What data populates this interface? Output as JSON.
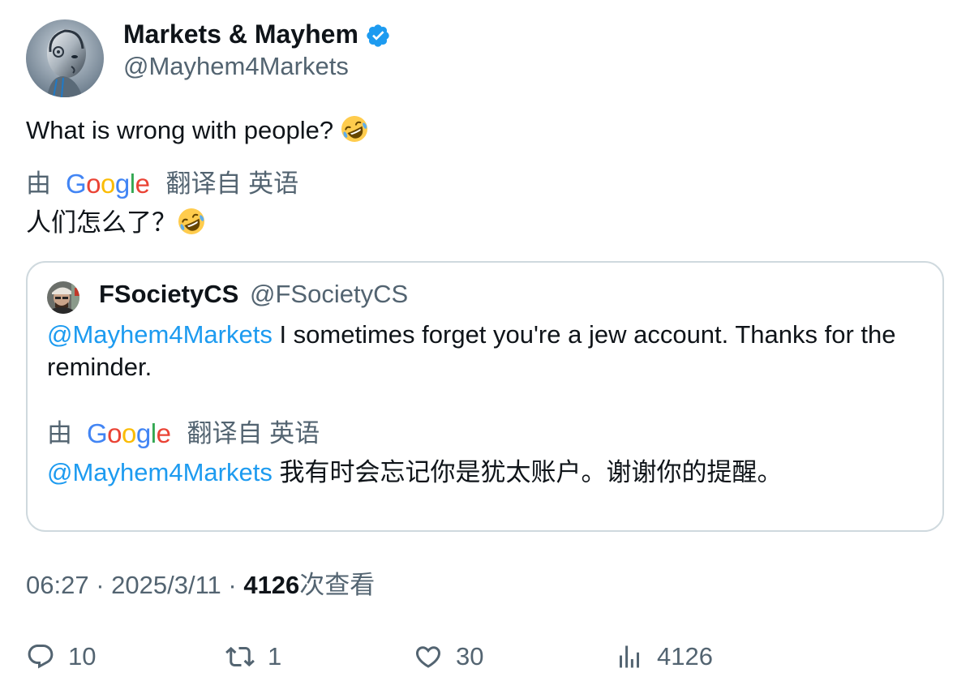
{
  "tweet": {
    "display_name": "Markets & Mayhem",
    "handle": "@Mayhem4Markets",
    "text": "What is wrong with people?",
    "translation": {
      "by_label": "由",
      "provider": "Google",
      "from_label": "翻译自 英语",
      "text": "人们怎么了？"
    }
  },
  "quote": {
    "display_name": "FSocietyCS",
    "handle": "@FSocietyCS",
    "mention": "@Mayhem4Markets",
    "text": " I sometimes forget you're a jew account. Thanks for the reminder.",
    "translation": {
      "by_label": "由",
      "provider": "Google",
      "from_label": "翻译自 英语",
      "mention": "@Mayhem4Markets",
      "text": " 我有时会忘记你是犹太账户。谢谢你的提醒。"
    }
  },
  "meta": {
    "time": "06:27",
    "separator": " · ",
    "date": "2025/3/11",
    "views_count": "4126",
    "views_label": "次查看"
  },
  "actions": {
    "replies": "10",
    "retweets": "1",
    "likes": "30",
    "views": "4126"
  },
  "colors": {
    "accent": "#1d9bf0",
    "secondary_text": "#536471",
    "border": "#cfd9de"
  }
}
